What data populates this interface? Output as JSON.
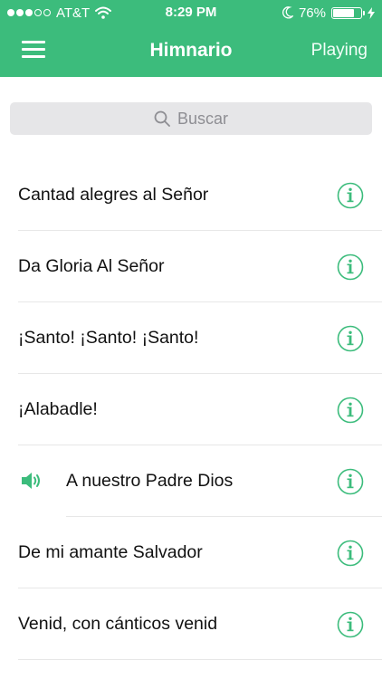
{
  "status_bar": {
    "carrier": "AT&T",
    "time": "8:29 PM",
    "battery_percent": "76%",
    "battery_level": 0.76,
    "signal_bars_filled": 3,
    "signal_bars_total": 5
  },
  "nav": {
    "title": "Himnario",
    "playing_label": "Playing"
  },
  "search": {
    "placeholder": "Buscar"
  },
  "colors": {
    "accent": "#3cbc7c",
    "separator": "#e7e7e7",
    "search_bg": "#e6e6e8"
  },
  "hymns": [
    {
      "title": "Cantad alegres al Señor",
      "playing": false
    },
    {
      "title": "Da Gloria Al Señor",
      "playing": false
    },
    {
      "title": "¡Santo! ¡Santo! ¡Santo!",
      "playing": false
    },
    {
      "title": "¡Alabadle!",
      "playing": false
    },
    {
      "title": "A nuestro Padre Dios",
      "playing": true
    },
    {
      "title": "De mi amante Salvador",
      "playing": false
    },
    {
      "title": "Venid, con cánticos venid",
      "playing": false
    }
  ],
  "icons": {
    "menu": "hamburger-menu-icon",
    "search": "search-icon",
    "info": "info-icon",
    "speaker": "speaker-icon",
    "wifi": "wifi-icon",
    "moon": "moon-icon",
    "charging": "charging-bolt-icon"
  }
}
